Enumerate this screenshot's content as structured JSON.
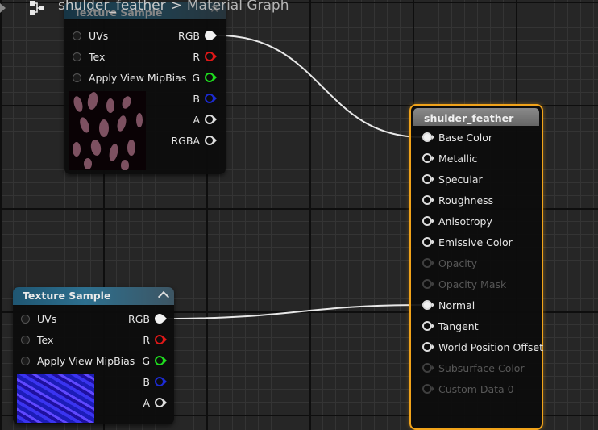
{
  "breadcrumb": {
    "asset": "shulder_feather",
    "separator": ">",
    "section": "Material Graph"
  },
  "icons": {
    "nav_arrow": "play-arrow-icon",
    "graph": "graph-icon",
    "close": "close-icon",
    "collapse": "chevron-up-icon"
  },
  "colors": {
    "selection_outline": "#f1a31a",
    "texture_header": "#2d6f8e",
    "material_header": "#7a7a7a",
    "pin_red": "#e01818",
    "pin_green": "#1fdc1f",
    "pin_blue": "#1c2bd4"
  },
  "texture_node_top": {
    "title": "Texture Sample",
    "inputs": [
      "UVs",
      "Tex",
      "Apply View MipBias"
    ],
    "outputs": [
      "RGB",
      "R",
      "G",
      "B",
      "A",
      "RGBA"
    ]
  },
  "texture_node_bottom": {
    "title": "Texture Sample",
    "inputs": [
      "UVs",
      "Tex",
      "Apply View MipBias"
    ],
    "outputs": [
      "RGB",
      "R",
      "G",
      "B",
      "A"
    ]
  },
  "material_node": {
    "title": "shulder_feather",
    "inputs": [
      {
        "label": "Base Color",
        "enabled": true,
        "connected": true
      },
      {
        "label": "Metallic",
        "enabled": true,
        "connected": false
      },
      {
        "label": "Specular",
        "enabled": true,
        "connected": false
      },
      {
        "label": "Roughness",
        "enabled": true,
        "connected": false
      },
      {
        "label": "Anisotropy",
        "enabled": true,
        "connected": false
      },
      {
        "label": "Emissive Color",
        "enabled": true,
        "connected": false
      },
      {
        "label": "Opacity",
        "enabled": false,
        "connected": false
      },
      {
        "label": "Opacity Mask",
        "enabled": false,
        "connected": false
      },
      {
        "label": "Normal",
        "enabled": true,
        "connected": true
      },
      {
        "label": "Tangent",
        "enabled": true,
        "connected": false
      },
      {
        "label": "World Position Offset",
        "enabled": true,
        "connected": false
      },
      {
        "label": "Subsurface Color",
        "enabled": false,
        "connected": false
      },
      {
        "label": "Custom Data 0",
        "enabled": false,
        "connected": false
      }
    ]
  }
}
